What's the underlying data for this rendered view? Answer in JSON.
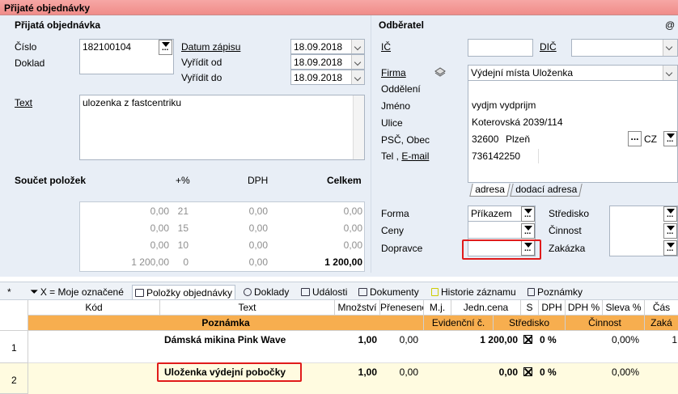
{
  "window": {
    "title": "Přijaté objednávky"
  },
  "order": {
    "section_title": "Přijatá objednávka",
    "cislo_label": "Číslo",
    "cislo_value": "182100104",
    "doklad_label": "Doklad",
    "datum_zapisu_label": "Datum zápisu",
    "datum_zapisu_value": "18.09.2018",
    "vyridit_od_label": "Vyřídit od",
    "vyridit_od_value": "18.09.2018",
    "vyridit_do_label": "Vyřídit do",
    "vyridit_do_value": "18.09.2018",
    "text_label": "Text",
    "text_value": "ulozenka z fastcentriku"
  },
  "summary": {
    "title": "Součet položek",
    "col_percent": "+%",
    "col_dph": "DPH",
    "col_total": "Celkem",
    "rows": [
      {
        "base": "0,00",
        "pct": "21",
        "dph": "0,00",
        "total": "0,00"
      },
      {
        "base": "0,00",
        "pct": "15",
        "dph": "0,00",
        "total": "0,00"
      },
      {
        "base": "0,00",
        "pct": "10",
        "dph": "0,00",
        "total": "0,00"
      },
      {
        "base": "1 200,00",
        "pct": "0",
        "dph": "0,00",
        "total": "1 200,00"
      }
    ]
  },
  "customer": {
    "section_title": "Odběratel",
    "at_symbol": "@",
    "ic_label": "IČ",
    "dic_label": "DIČ",
    "firma_label": "Firma",
    "firma_value": "Výdejní místa Uloženka",
    "oddeleni_label": "Oddělení",
    "jmeno_label": "Jméno",
    "jmeno_value": "vydjm vydprijm",
    "ulice_label": "Ulice",
    "ulice_value": "Koterovská 2039/114",
    "psc_label": "PSČ, Obec",
    "psc_value": "32600",
    "obec_value": "Plzeň",
    "country_value": "CZ",
    "tel_label": "Tel ,",
    "email_label": "E-mail",
    "tel_value": "736142250",
    "tab_adresa": "adresa",
    "tab_dodaci": "dodací adresa",
    "forma_label": "Forma",
    "forma_value": "Příkazem",
    "ceny_label": "Ceny",
    "dopravce_label": "Dopravce",
    "stredisko_label": "Středisko",
    "cinnost_label": "Činnost",
    "zakazka_label": "Zakázka"
  },
  "tabs": [
    {
      "label": "*"
    },
    {
      "label": "X = Moje označené"
    },
    {
      "label": "Položky objednávky"
    },
    {
      "label": "Doklady"
    },
    {
      "label": "Události"
    },
    {
      "label": "Dokumenty"
    },
    {
      "label": "Historie záznamu"
    },
    {
      "label": "Poznámky"
    }
  ],
  "grid": {
    "headers": [
      "Kód",
      "Text",
      "Množství",
      "Přenesené",
      "M.j.",
      "Jedn.cena",
      "S",
      "DPH",
      "DPH %",
      "Sleva %",
      "Čás"
    ],
    "subheaders": [
      "Poznámka",
      "Evidenční č.",
      "Středisko",
      "Činnost",
      "Zaká"
    ],
    "rows": [
      {
        "no": "1",
        "text": "Dámská mikina Pink Wave",
        "qty": "1,00",
        "prenesene": "0,00",
        "price": "1 200,00",
        "dph": "0 %",
        "sleva": "0,00%",
        "cast": "1"
      },
      {
        "no": "2",
        "text": "Uloženka výdejní pobočky",
        "qty": "1,00",
        "prenesene": "0,00",
        "price": "0,00",
        "dph": "0 %",
        "sleva": "0,00%",
        "cast": ""
      }
    ]
  },
  "colors": {
    "title_bar": "#f08c89",
    "form_bg": "#e8eef6",
    "highlight": "#e01b1b",
    "subheader": "#f7ae4f",
    "selected_row": "#fffbe0"
  }
}
